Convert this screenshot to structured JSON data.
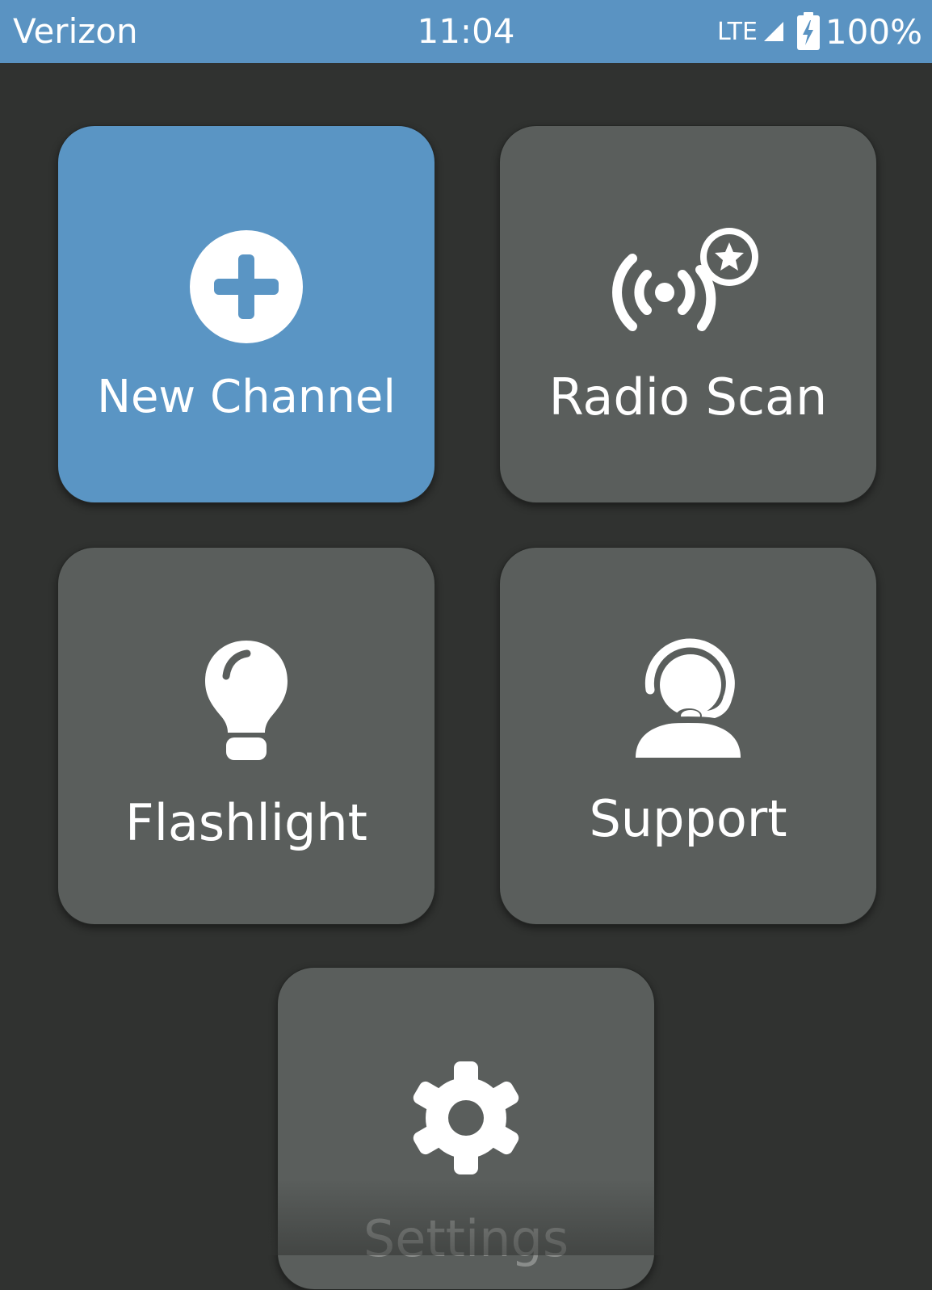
{
  "status_bar": {
    "carrier": "Verizon",
    "time": "11:04",
    "network": "LTE",
    "battery_percent": "100%"
  },
  "tiles": [
    {
      "label": "New Channel",
      "icon": "add-circle-icon"
    },
    {
      "label": "Radio Scan",
      "icon": "radio-scan-icon"
    },
    {
      "label": "Flashlight",
      "icon": "lightbulb-icon"
    },
    {
      "label": "Support",
      "icon": "headset-icon"
    },
    {
      "label": "Settings",
      "icon": "gear-icon"
    }
  ],
  "colors": {
    "accent": "#5a95c4",
    "tile": "#5a5e5c",
    "background": "#303230",
    "status_bar": "#5a93c2"
  }
}
